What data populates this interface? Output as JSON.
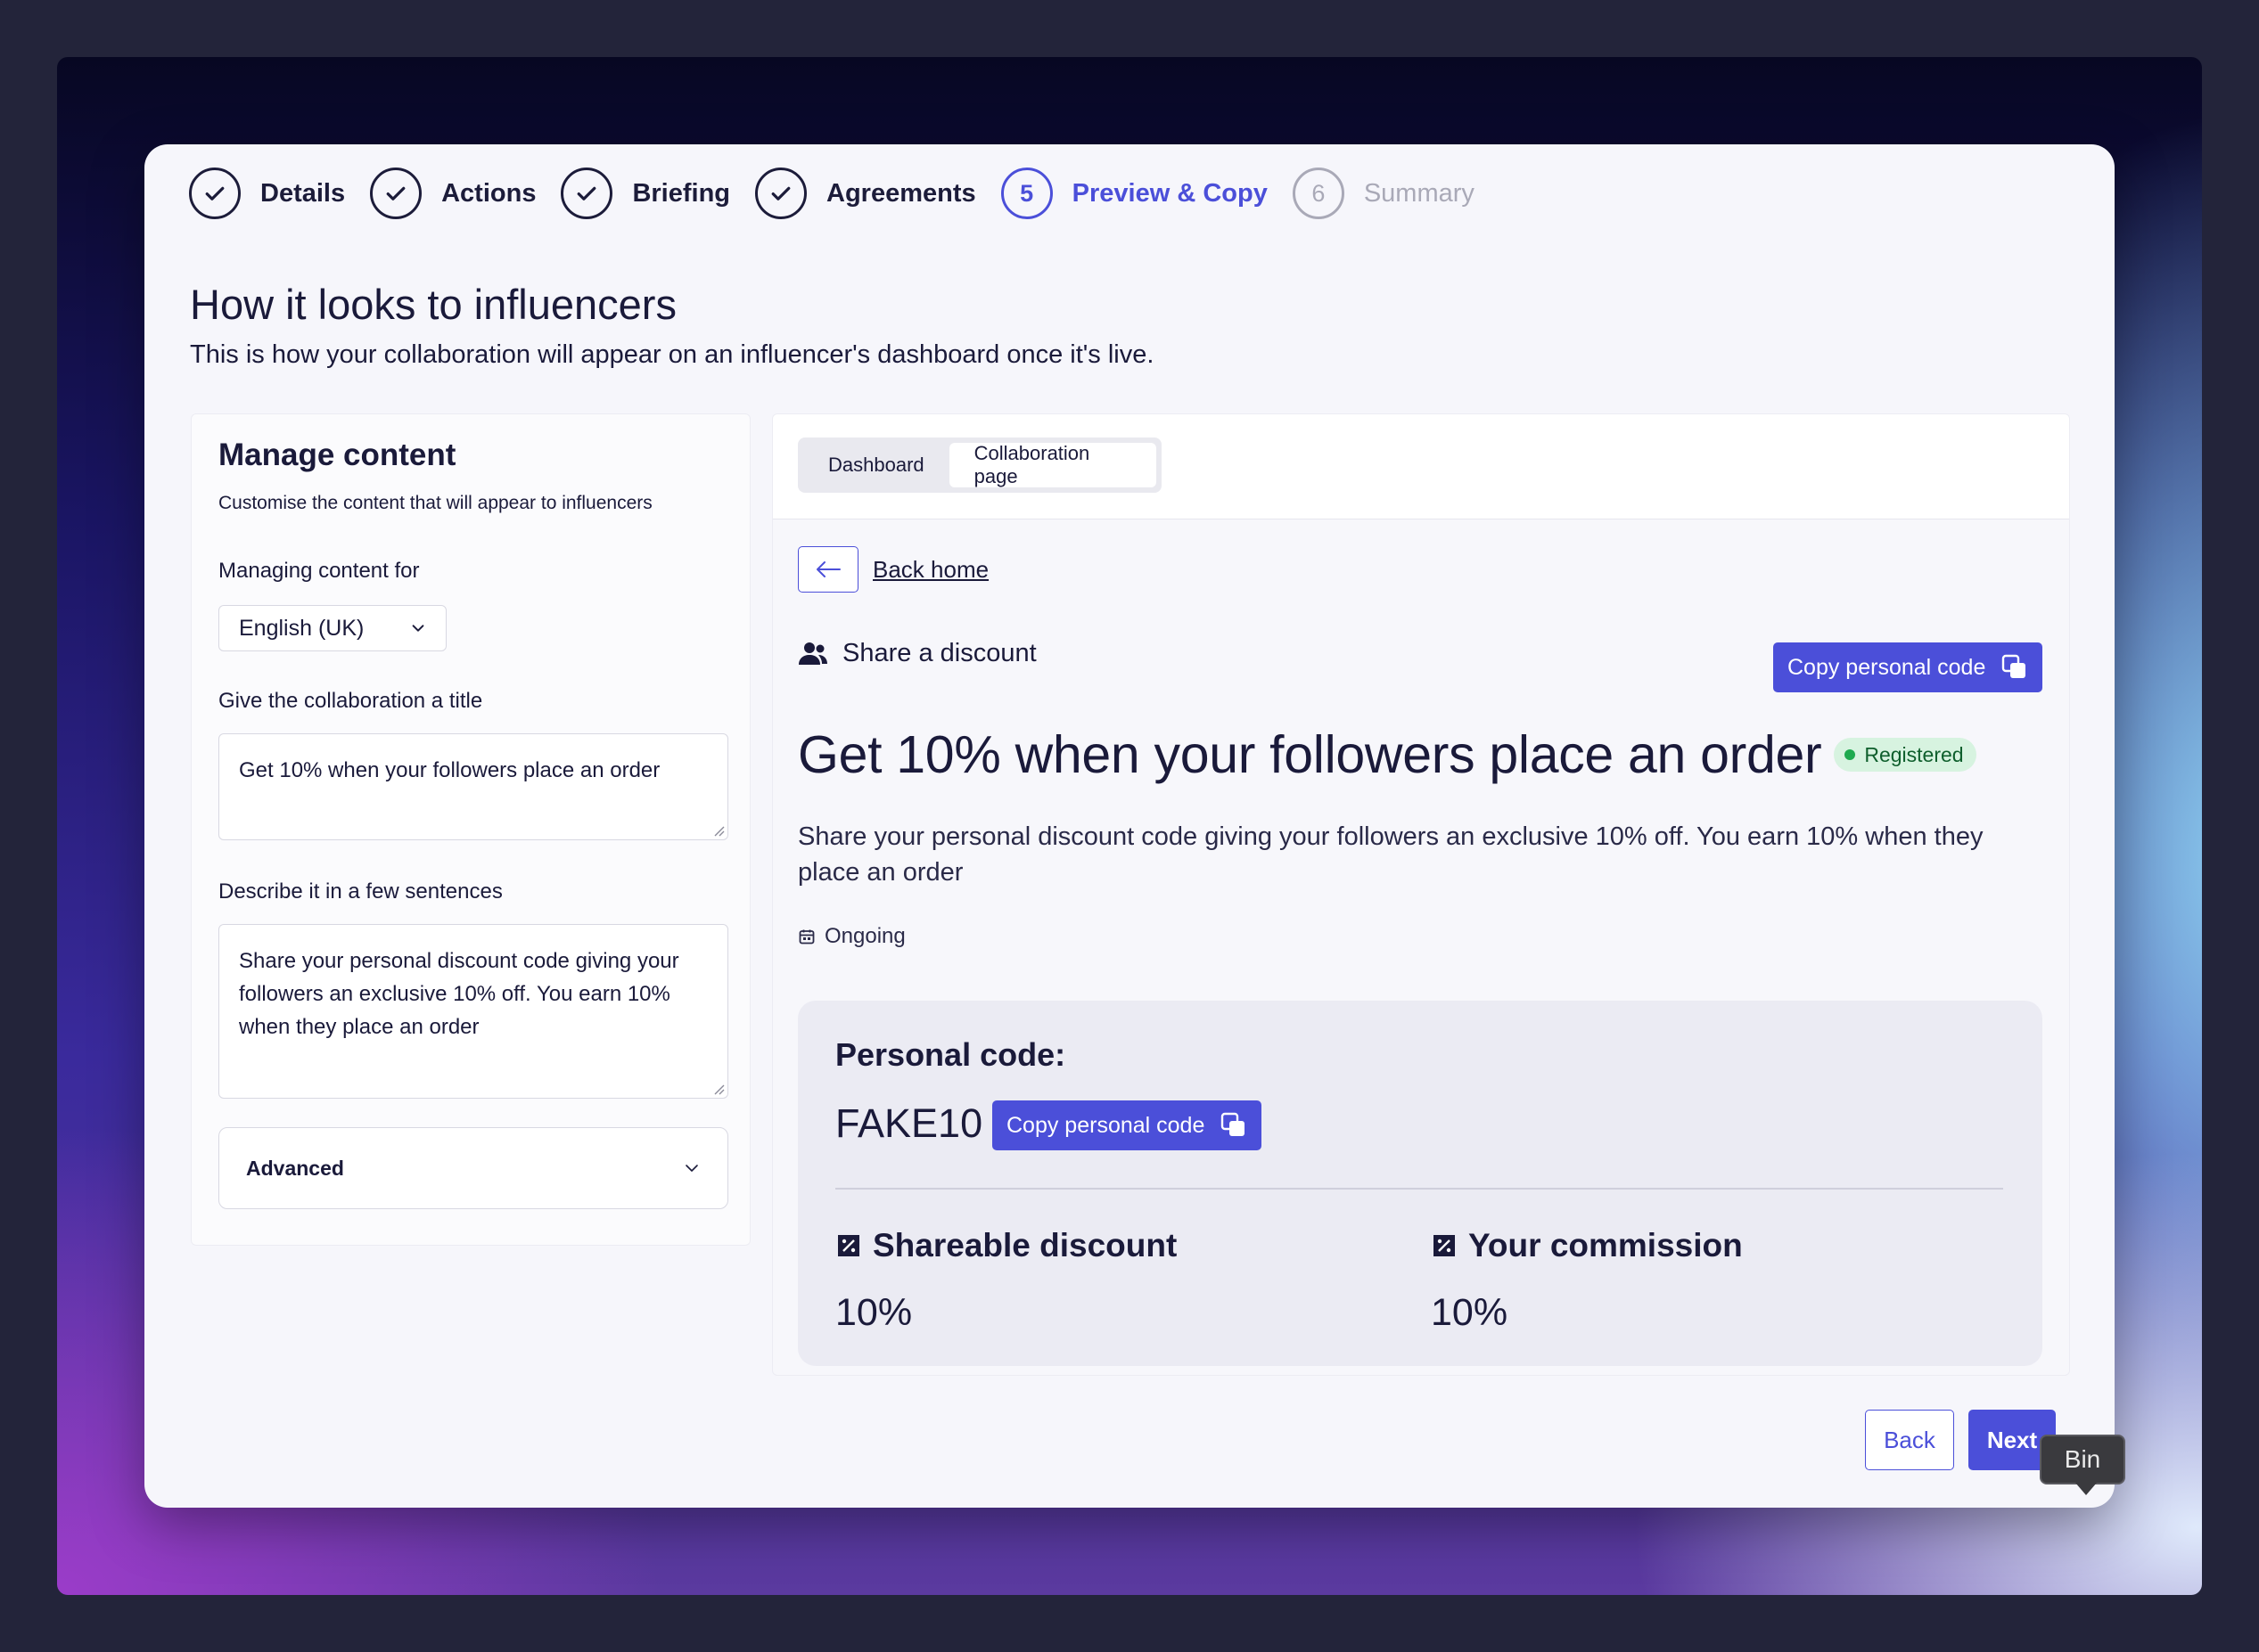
{
  "stepper": {
    "steps": [
      {
        "number": "1",
        "label": "Details",
        "state": "done"
      },
      {
        "number": "2",
        "label": "Actions",
        "state": "done"
      },
      {
        "number": "3",
        "label": "Briefing",
        "state": "done"
      },
      {
        "number": "4",
        "label": "Agreements",
        "state": "done"
      },
      {
        "number": "5",
        "label": "Preview & Copy",
        "state": "active"
      },
      {
        "number": "6",
        "label": "Summary",
        "state": "pending"
      }
    ]
  },
  "page": {
    "title": "How it looks to influencers",
    "subtitle": "This is how your collaboration will appear on an influencer's dashboard once it's live."
  },
  "manage": {
    "title": "Manage content",
    "subtitle": "Customise the content that will appear to influencers",
    "language_label": "Managing content for",
    "language_value": "English (UK)",
    "title_label": "Give the collaboration a title",
    "title_value": "Get 10% when your followers place an order",
    "description_label": "Describe it in a few sentences",
    "description_value": "Share your personal discount code giving your followers an exclusive 10% off. You earn 10% when they place an order",
    "advanced_label": "Advanced"
  },
  "preview": {
    "tabs": [
      {
        "label": "Dashboard",
        "selected": false
      },
      {
        "label": "Collaboration page",
        "selected": true
      }
    ],
    "back_home": "Back home",
    "action_type": "Share a discount",
    "copy_code_label": "Copy personal code",
    "collab_title": "Get 10% when your followers place an order",
    "status_badge": "Registered",
    "collab_description": "Share your personal discount code giving your followers an exclusive 10% off. You earn 10% when they place an order",
    "duration": "Ongoing",
    "personal_code_label": "Personal code:",
    "personal_code": "FAKE10",
    "shareable_discount_label": "Shareable discount",
    "shareable_discount_value": "10%",
    "commission_label": "Your commission",
    "commission_value": "10%"
  },
  "footer": {
    "back_label": "Back",
    "next_label": "Next"
  },
  "tooltip": {
    "text": "Bin"
  },
  "colors": {
    "accent": "#4b4fd9",
    "success_bg": "#d7f3e0",
    "success_dot": "#1eaa4f"
  }
}
